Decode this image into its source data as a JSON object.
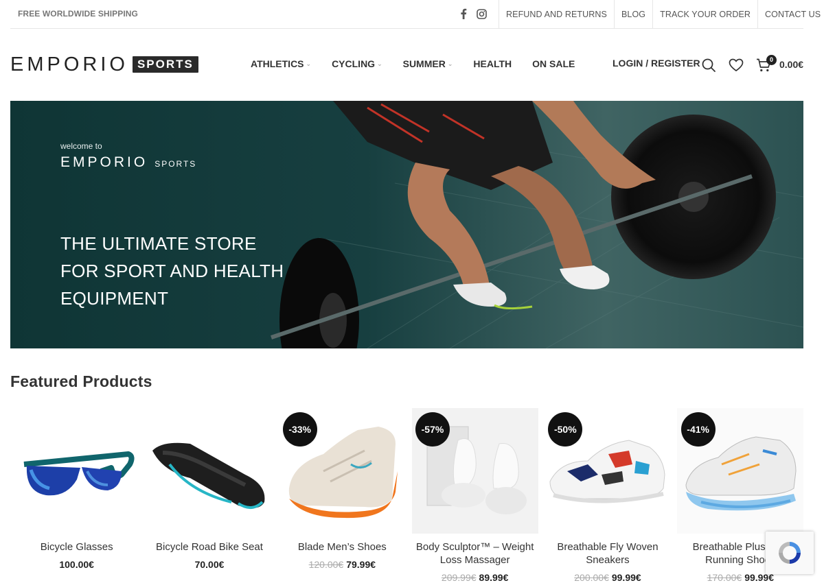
{
  "topbar": {
    "shipping": "FREE WORLDWIDE SHIPPING",
    "social": [
      "facebook-icon",
      "instagram-icon"
    ],
    "links": [
      "REFUND AND RETURNS",
      "BLOG",
      "TRACK YOUR ORDER",
      "CONTACT US"
    ]
  },
  "header": {
    "logo_word": "EMPORIO",
    "logo_badge": "SPORTS",
    "nav": [
      {
        "label": "ATHLETICS",
        "dropdown": true
      },
      {
        "label": "CYCLING",
        "dropdown": true
      },
      {
        "label": "SUMMER",
        "dropdown": true
      },
      {
        "label": "HEALTH",
        "dropdown": false
      },
      {
        "label": "ON SALE",
        "dropdown": false
      }
    ],
    "login": "LOGIN / REGISTER",
    "cart_count": "0",
    "cart_total": "0.00€"
  },
  "hero": {
    "welcome": "welcome to",
    "logo_word": "EMPORIO",
    "logo_sub": "SPORTS",
    "tagline": [
      "THE ULTIMATE STORE",
      "FOR SPORT AND HEALTH",
      "EQUIPMENT"
    ]
  },
  "featured": {
    "title": "Featured Products",
    "products": [
      {
        "name": "Bicycle Glasses",
        "sale": "",
        "old_price": "",
        "price": "100.00€",
        "icon": "sunglasses"
      },
      {
        "name": "Bicycle Road Bike Seat",
        "sale": "",
        "old_price": "",
        "price": "70.00€",
        "icon": "bike-seat"
      },
      {
        "name": "Blade Men’s Shoes",
        "sale": "-33%",
        "old_price": "120.00€",
        "price": "79.99€",
        "icon": "shoe"
      },
      {
        "name": "Body Sculptor™ – Weight Loss Massager",
        "sale": "-57%",
        "old_price": "209.99€",
        "price": "89.99€",
        "icon": "massager"
      },
      {
        "name": "Breathable Fly Woven Sneakers",
        "sale": "-50%",
        "old_price": "200.00€",
        "price": "99.99€",
        "icon": "sneaker"
      },
      {
        "name": "Breathable Plus Size Running Shoes",
        "sale": "-41%",
        "old_price": "170.00€",
        "price": "99.99€",
        "icon": "running-shoe"
      }
    ]
  },
  "colors": {
    "accent": "#111111",
    "hero_bg": "#123a3a",
    "text": "#333333"
  }
}
